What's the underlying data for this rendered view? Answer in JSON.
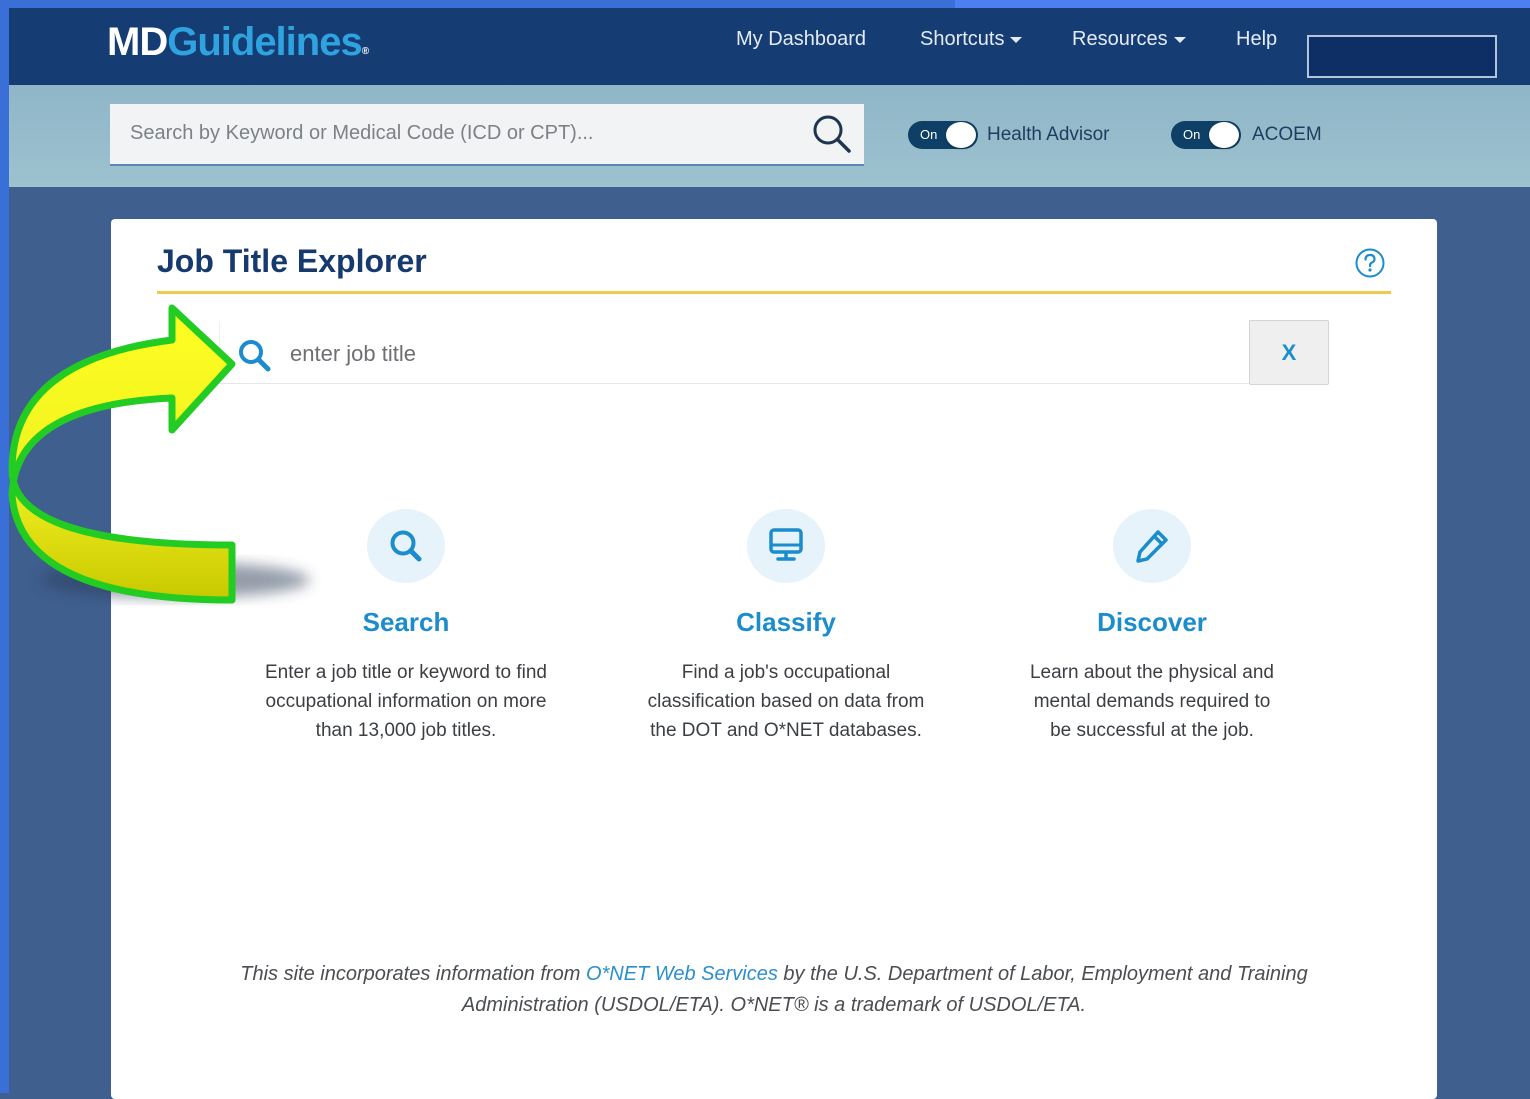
{
  "header": {
    "logo": {
      "primary": "MD",
      "secondary": "Guidelines",
      "mark": "®"
    },
    "nav": [
      {
        "label": "My Dashboard",
        "dropdown": false
      },
      {
        "label": "Shortcuts",
        "dropdown": true
      },
      {
        "label": "Resources",
        "dropdown": true
      },
      {
        "label": "Help",
        "dropdown": false
      }
    ]
  },
  "search_band": {
    "placeholder": "Search by Keyword or Medical Code (ICD or CPT)...",
    "toggles": [
      {
        "state": "On",
        "label": "Health Advisor"
      },
      {
        "state": "On",
        "label": "ACOEM"
      }
    ]
  },
  "card": {
    "title": "Job Title Explorer",
    "job_input": {
      "placeholder": "enter job title",
      "value": ""
    },
    "clear_label": "X",
    "features": [
      {
        "title": "Search",
        "icon": "search-icon",
        "description": [
          "Enter a job title or keyword to find",
          "occupational information on more",
          "than 13,000 job titles."
        ]
      },
      {
        "title": "Classify",
        "icon": "monitor-icon",
        "description": [
          "Find a job's occupational",
          "classification based on data from",
          "the DOT and O*NET databases."
        ]
      },
      {
        "title": "Discover",
        "icon": "pencil-icon",
        "description": [
          "Learn about the physical and",
          "mental demands required to",
          "be successful at the job."
        ]
      }
    ],
    "footer": {
      "before_link": "This site incorporates information from ",
      "link": "O*NET Web Services",
      "after_link": " by the U.S. Department of Labor, Employment and Training",
      "line2": "Administration (USDOL/ETA). O*NET® is a trademark of USDOL/ETA."
    }
  },
  "colors": {
    "header_bg": "#153d74",
    "brand_blue": "#2ea3df",
    "title_rule": "#f2c94c",
    "accent_blue": "#1b8ccc",
    "arrow_fill": "#ffff33",
    "arrow_outline": "#22cc22"
  }
}
